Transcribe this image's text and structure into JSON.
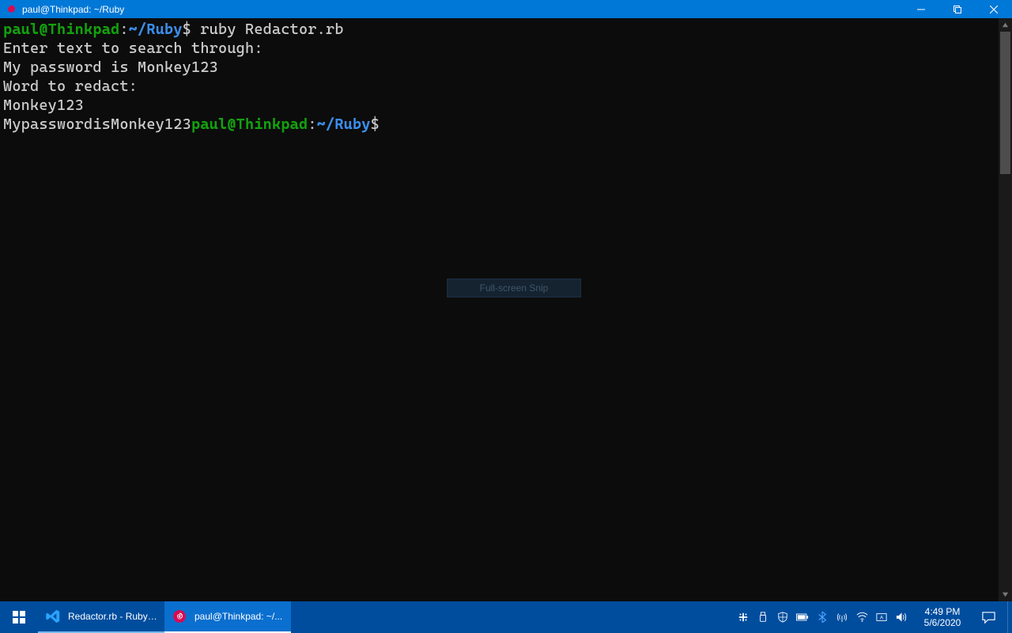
{
  "window": {
    "title": "paul@Thinkpad: ~/Ruby",
    "controls": {
      "minimize": "minimize",
      "maximize": "maximize",
      "close": "close"
    },
    "icon": "debian-swirl-icon"
  },
  "colors": {
    "accent": "#0078d7",
    "terminal_bg": "#0c0c0c",
    "prompt_user": "#13a10e",
    "prompt_path": "#3b8eea",
    "fg": "#cccccc",
    "taskbar": "#004d9e"
  },
  "terminal": {
    "prompt1": {
      "user_host": "paul@Thinkpad",
      "colon": ":",
      "path": "~/Ruby",
      "sigil": "$ ",
      "command": "ruby Redactor.rb"
    },
    "lines": [
      "Enter text to search through:",
      "My password is Monkey123",
      "Word to redact:",
      "Monkey123"
    ],
    "output_inline": "MypasswordisMonkey123",
    "prompt2": {
      "user_host": "paul@Thinkpad",
      "colon": ":",
      "path": "~/Ruby",
      "sigil": "$ ",
      "command": ""
    }
  },
  "snip": {
    "label": "Full-screen Snip"
  },
  "taskbar": {
    "start": "start",
    "items": [
      {
        "icon": "vscode-icon",
        "label": "Redactor.rb - Ruby ...",
        "state": "running"
      },
      {
        "icon": "debian-swirl-icon",
        "label": "paul@Thinkpad: ~/...",
        "state": "active"
      }
    ],
    "tray_icons": [
      "slack-icon",
      "usb-icon",
      "security-icon",
      "battery-icon",
      "bluetooth-icon",
      "antenna-icon",
      "wifi-icon",
      "ime-icon",
      "volume-icon"
    ],
    "clock": {
      "time": "4:49 PM",
      "date": "5/6/2020"
    },
    "action_center": "action-center"
  }
}
